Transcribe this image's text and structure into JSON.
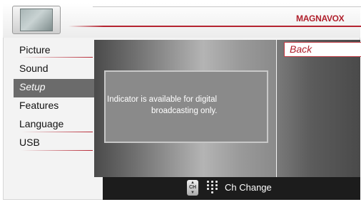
{
  "header": {
    "brand": "MAGNAVOX",
    "icon": "tv-icon"
  },
  "menu": {
    "items": [
      {
        "label": "Picture"
      },
      {
        "label": "Sound"
      },
      {
        "label": "Setup",
        "selected": true
      },
      {
        "label": "Features"
      },
      {
        "label": "Language"
      },
      {
        "label": "USB"
      }
    ]
  },
  "submenu": {
    "back_label": "Back"
  },
  "message": {
    "line1": "Indicator is available for digital",
    "line2": "broadcasting only."
  },
  "footer": {
    "ch_icon_text": "CH",
    "keypad_icon": "keypad-icon",
    "hint_label": "Ch Change"
  },
  "colors": {
    "brand_red": "#b0202c",
    "selected_bg": "#6b6b6b",
    "footer_bg": "#1c1c1c"
  }
}
